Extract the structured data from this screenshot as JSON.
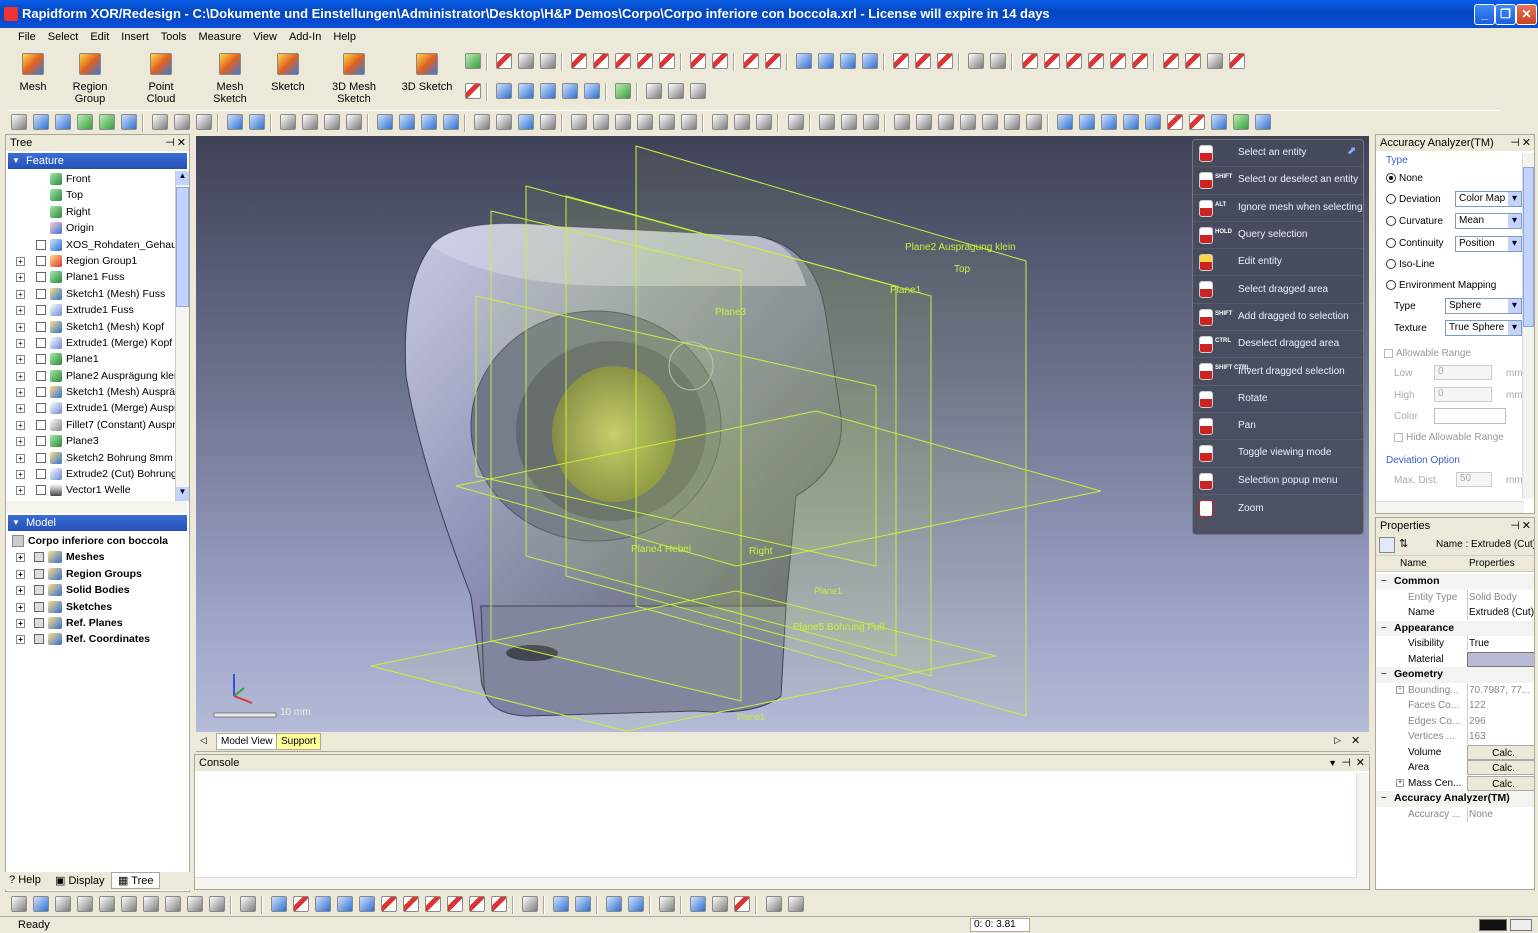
{
  "window": {
    "title": "Rapidform XOR/Redesign - C:\\Dokumente und Einstellungen\\Administrator\\Desktop\\H&P Demos\\Corpo\\Corpo inferiore con boccola.xrl - License will expire in 14 days"
  },
  "menu": [
    "File",
    "Select",
    "Edit",
    "Insert",
    "Tools",
    "Measure",
    "View",
    "Add-In",
    "Help"
  ],
  "modes": [
    "Mesh",
    "Region Group",
    "Point Cloud",
    "Mesh Sketch",
    "Sketch",
    "3D Mesh Sketch",
    "3D Sketch"
  ],
  "tree": {
    "title": "Tree",
    "feature_header": "Feature",
    "items": [
      "Front",
      "Top",
      "Right",
      "Origin",
      "XOS_Rohdaten_Gehause",
      "Region Group1",
      "Plane1 Fuss",
      "Sketch1 (Mesh) Fuss",
      "Extrude1 Fuss",
      "Sketch1 (Mesh) Kopf",
      "Extrude1 (Merge) Kopf",
      "Plane1",
      "Plane2 Ausprägung klein",
      "Sketch1 (Mesh) Ausprägu",
      "Extrude1 (Merge) Auspräg",
      "Fillet7 (Constant) Auspräg",
      "Plane3",
      "Sketch2 Bohrung 8mm",
      "Extrude2 (Cut) Bohrung 8",
      "Vector1 Welle"
    ],
    "model_header": "Model",
    "model_root": "Corpo inferiore con boccola",
    "model_items": [
      "Meshes",
      "Region Groups",
      "Solid Bodies",
      "Sketches",
      "Ref. Planes",
      "Ref. Coordinates"
    ],
    "bottom_tabs": [
      "Help",
      "Display",
      "Tree"
    ]
  },
  "viewport": {
    "labels": {
      "plane2": "Plane2 Ausprägung klein",
      "top": "Top",
      "plane1": "Plane1",
      "plane3": "Plane3",
      "plane4": "Plane4 Hebel",
      "right": "Right",
      "plane5": "Plane5 Bohrung Fuß",
      "planef": "Plane1",
      "planeg": "Plane1"
    },
    "scale": "10 mm",
    "tabs": [
      "Model View",
      "Support"
    ]
  },
  "mouse_menu": [
    {
      "key": "",
      "label": "Select an entity"
    },
    {
      "key": "SHIFT",
      "label": "Select or deselect an entity"
    },
    {
      "key": "ALT",
      "label": "Ignore mesh when selecting"
    },
    {
      "key": "HOLD",
      "label": "Query selection"
    },
    {
      "key": "",
      "label": "Edit entity"
    },
    {
      "key": "",
      "label": "Select dragged area"
    },
    {
      "key": "SHIFT",
      "label": "Add dragged to selection"
    },
    {
      "key": "CTRL",
      "label": "Deselect dragged area"
    },
    {
      "key": "SHIFT CTRL",
      "label": "Invert dragged selection"
    },
    {
      "key": "",
      "label": "Rotate"
    },
    {
      "key": "",
      "label": "Pan"
    },
    {
      "key": "",
      "label": "Toggle viewing mode"
    },
    {
      "key": "",
      "label": "Selection popup menu"
    },
    {
      "key": "",
      "label": "Zoom"
    }
  ],
  "console": {
    "title": "Console"
  },
  "analyzer": {
    "title": "Accuracy Analyzer(TM)",
    "type_label": "Type",
    "options": [
      "None",
      "Deviation",
      "Curvature",
      "Continuity",
      "Iso-Line",
      "Environment Mapping"
    ],
    "deviation_combo": "Color Map",
    "curvature_combo": "Mean",
    "continuity_combo": "Position",
    "type_row": "Type",
    "type_combo": "Sphere",
    "texture_row": "Texture",
    "texture_combo": "True Sphere",
    "allowable_range": "Allowable Range",
    "low": "Low",
    "high": "High",
    "low_val": "0",
    "high_val": "0",
    "mm": "mm",
    "color": "Color",
    "hide_range": "Hide Allowable Range",
    "deviation_option": "Deviation Option",
    "max_dist": "Max. Dist.",
    "max_val": "50"
  },
  "properties": {
    "title": "Properties",
    "name_label": "Name : Extrude8 (Cut)",
    "col_name": "Name",
    "col_props": "Properties",
    "sections": [
      {
        "title": "Common",
        "rows": [
          [
            "Entity Type",
            "Solid Body"
          ],
          [
            "Name",
            "Extrude8 (Cut)"
          ]
        ]
      },
      {
        "title": "Appearance",
        "rows": [
          [
            "Visibility",
            "True"
          ],
          [
            "Material",
            ""
          ]
        ]
      },
      {
        "title": "Geometry",
        "rows": [
          [
            "Bounding...",
            "70.7987, 77..."
          ],
          [
            "Faces Co...",
            "122"
          ],
          [
            "Edges Co...",
            "296"
          ],
          [
            "Vertices ...",
            "163"
          ],
          [
            "Volume",
            "Calc."
          ],
          [
            "Area",
            "Calc."
          ],
          [
            "Mass Cen...",
            "Calc."
          ]
        ]
      },
      {
        "title": "Accuracy Analyzer(TM)",
        "rows": [
          [
            "Accuracy ...",
            "None"
          ]
        ]
      }
    ]
  },
  "status": {
    "text": "Ready",
    "coords": "0: 0: 3.81"
  },
  "colors": {
    "title_bar": "#0a4fd8",
    "feature_bar": "#2450b8",
    "viewport_top": "#3f4257",
    "viewport_bottom": "#b4bbd8",
    "plane_lines": "#c8f03c"
  }
}
